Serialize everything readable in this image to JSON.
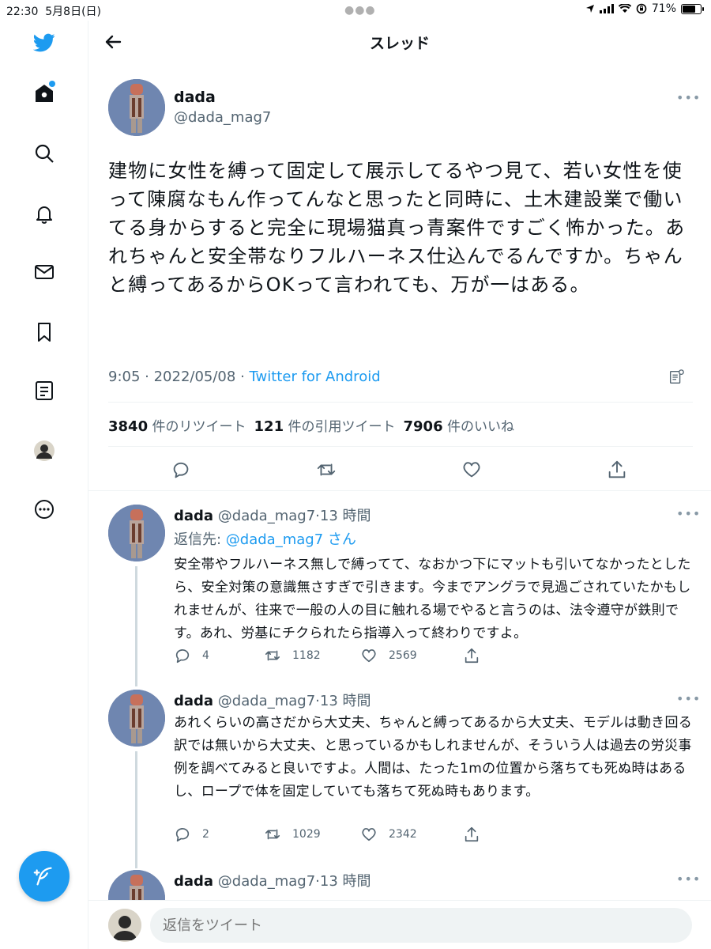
{
  "status_bar": {
    "time": "22:30",
    "date": "5月8日(日)",
    "battery": "71%",
    "battery_level": 0.71
  },
  "header": {
    "title": "スレッド"
  },
  "main_tweet": {
    "name": "dada",
    "handle": "@dada_mag7",
    "text": "建物に女性を縛って固定して展示してるやつ見て、若い女性を使って陳腐なもん作ってんなと思ったと同時に、土木建設業で働いてる身からすると完全に現場猫真っ青案件ですごく怖かった。あれちゃんと安全帯なりフルハーネス仕込んでるんですか。ちゃんと縛ってあるからOKって言われても、万が一はある。",
    "time": "9:05",
    "date": "2022/05/08",
    "via": "Twitter for Android",
    "stats": {
      "retweets": "3840",
      "retweets_label": "件のリツイート",
      "quotes": "121",
      "quotes_label": "件の引用ツイート",
      "likes": "7906",
      "likes_label": "件のいいね"
    }
  },
  "replies": [
    {
      "name": "dada",
      "handle": "@dada_mag7",
      "time": "13 時間",
      "reply_to_label": "返信先: ",
      "reply_to_user": "@dada_mag7 さん",
      "text": "安全帯やフルハーネス無しで縛ってて、なおかつ下にマットも引いてなかったとしたら、安全対策の意識無さすぎで引きます。今までアングラで見過ごされていたかもしれませんが、往来で一般の人の目に触れる場でやると言うのは、法令遵守が鉄則です。あれ、労基にチクられたら指導入って終わりですよ。",
      "reply_count": "4",
      "retweet_count": "1182",
      "like_count": "2569"
    },
    {
      "name": "dada",
      "handle": "@dada_mag7",
      "time": "13 時間",
      "text": "あれくらいの高さだから大丈夫、ちゃんと縛ってあるから大丈夫、モデルは動き回る訳では無いから大丈夫、と思っているかもしれませんが、そういう人は過去の労災事例を調べてみると良いですよ。人間は、たった1mの位置から落ちても死ぬ時はあるし、ロープで体を固定していても落ちて死ぬ時もあります。",
      "reply_count": "2",
      "retweet_count": "1029",
      "like_count": "2342"
    },
    {
      "name": "dada",
      "handle": "@dada_mag7",
      "time": "13 時間"
    }
  ],
  "composer": {
    "placeholder": "返信をツイート"
  },
  "colors": {
    "accent": "#1d9bf0",
    "text": "#0f1419",
    "secondary": "#536471"
  }
}
